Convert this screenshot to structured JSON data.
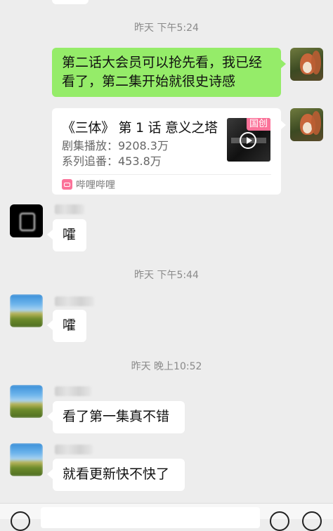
{
  "messages": {
    "time1": "昨天 下午5:24",
    "sent_text": "第二话大会员可以抢先看，我已经看了，第二集开始就很史诗感",
    "card": {
      "title": "《三体》 第 1 话 意义之塔",
      "plays": "剧集播放：9208.3万",
      "follows": "系列追番：453.8万",
      "thumb_badge": "国创",
      "source_name": "哔哩哔哩",
      "source_logo": "bilibili"
    },
    "msg1": "嚯",
    "time2": "昨天 下午5:44",
    "msg2": "嚯",
    "time3": "昨天 晚上10:52",
    "msg3": "看了第一集真不错",
    "msg4": "就看更新快不快了"
  },
  "colors": {
    "background": "#ededed",
    "sent_bubble": "#95ec69",
    "received_bubble": "#ffffff",
    "timestamp": "#8a8a8a",
    "bilibili_pink": "#fb7299"
  },
  "icons": {
    "voice": "voice-icon",
    "emoji": "emoji-icon",
    "add": "add-icon",
    "play": "play-icon"
  }
}
